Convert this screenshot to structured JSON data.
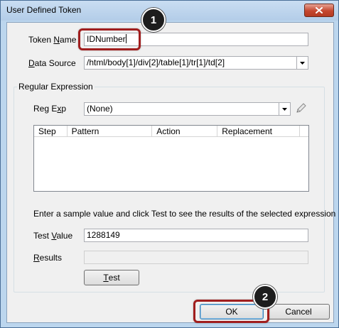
{
  "window": {
    "title": "User Defined Token"
  },
  "token_name": {
    "label_before": "Token ",
    "label_mnemonic": "N",
    "label_after": "ame",
    "value": "IDNumber"
  },
  "data_source": {
    "label_mnemonic": "D",
    "label_after": "ata Source",
    "value": "/html/body[1]/div[2]/table[1]/tr[1]/td[2]"
  },
  "regex_group": {
    "title": "Regular Expression",
    "reg_exp_label_before": "Reg E",
    "reg_exp_label_mnemonic": "x",
    "reg_exp_label_after": "p",
    "reg_exp_value": "(None)",
    "columns": [
      "Step",
      "Pattern",
      "Action",
      "Replacement"
    ],
    "rows": [],
    "hint": "Enter a sample value and click Test to see the results of the selected expression",
    "test_value_label_before": "Test ",
    "test_value_label_mnemonic": "V",
    "test_value_label_after": "alue",
    "test_value": "1288149",
    "results_label_mnemonic": "R",
    "results_label_after": "esults",
    "results_value": "",
    "test_button_mnemonic": "T",
    "test_button_after": "est"
  },
  "footer": {
    "ok_label": "OK",
    "cancel_label": "Cancel"
  },
  "annotations": {
    "step1": "1",
    "step2": "2",
    "highlight_color": "#a01e1e",
    "badge_color": "#1d1d1d"
  }
}
